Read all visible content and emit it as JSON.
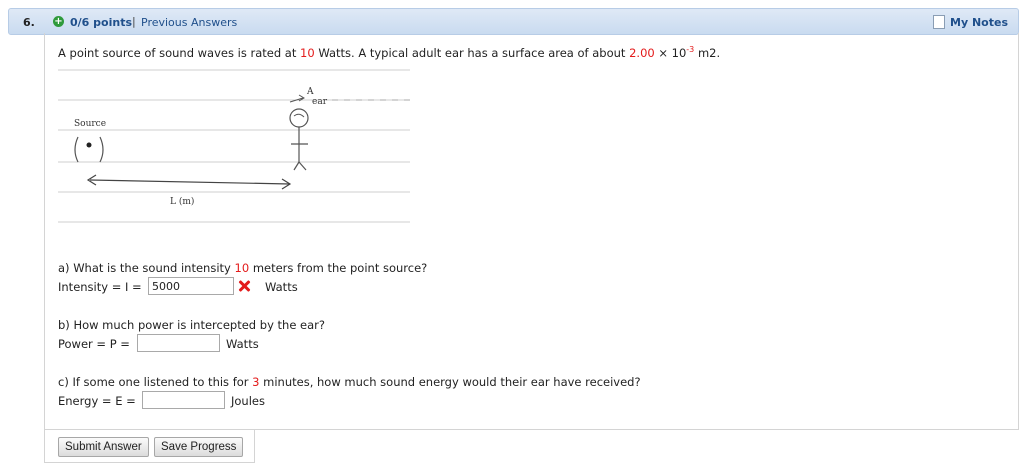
{
  "header": {
    "question_number": "6.",
    "points": "0/6 points",
    "separator": "|",
    "previous_answers": "Previous Answers",
    "my_notes": "My Notes"
  },
  "problem": {
    "intro_1": "A point source of sound waves is rated at",
    "power_watts": "10",
    "intro_2": "Watts. A typical adult ear has a surface area of about",
    "area_value": "2.00",
    "times": "× 10",
    "exponent": "-3",
    "area_unit": "m2."
  },
  "figure": {
    "label_a": "A",
    "label_ear": "ear",
    "label_source": "Source",
    "label_length": "L (m)"
  },
  "part_a": {
    "q1": "a) What is the sound intensity",
    "distance": "10",
    "q2": "meters from the point source?",
    "label": "Intensity = I =",
    "value": "5000",
    "unit": "Watts",
    "status": "incorrect"
  },
  "part_b": {
    "q": "b) How much power is intercepted by the ear?",
    "label": "Power = P =",
    "value": "",
    "unit": "Watts"
  },
  "part_c": {
    "q1": "c) If some one listened to this for",
    "minutes": "3",
    "q2": "minutes, how much sound energy would their ear have received?",
    "label": "Energy = E =",
    "value": "",
    "unit": "Joules"
  },
  "buttons": {
    "submit": "Submit Answer",
    "save": "Save Progress"
  },
  "colors": {
    "highlight": "#e31b1b",
    "link": "#1f4f8b",
    "header_bg": "#d3e2f4"
  }
}
